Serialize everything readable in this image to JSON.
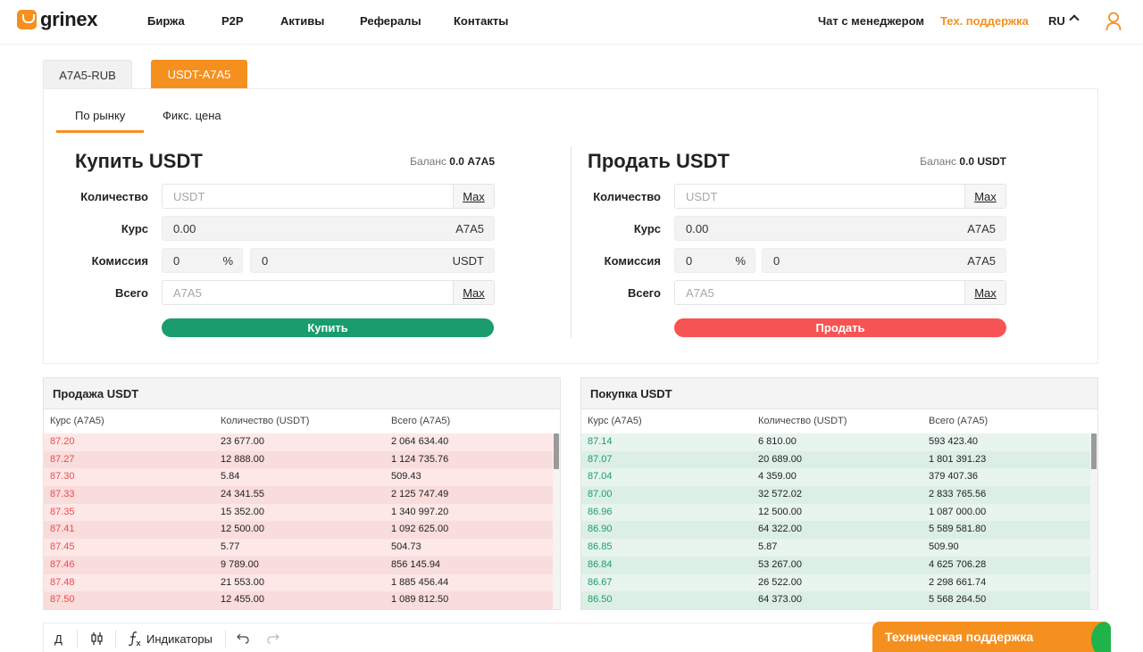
{
  "header": {
    "logo_text": "grinex",
    "nav": [
      "Биржа",
      "P2P",
      "Активы",
      "Рефералы",
      "Контакты"
    ],
    "chat_manager": "Чат с менеджером",
    "tech_support": "Тех. поддержка",
    "lang": "RU"
  },
  "pair_tabs": [
    "A7A5-RUB",
    "USDT-A7A5"
  ],
  "active_pair": "USDT-A7A5",
  "mode_tabs": [
    "По рынку",
    "Фикс. цена"
  ],
  "buy_form": {
    "title": "Купить USDT",
    "balance_label": "Баланс",
    "balance_value": "0.0 A7A5",
    "quantity_label": "Количество",
    "quantity_placeholder": "USDT",
    "max": "Max",
    "rate_label": "Курс",
    "rate_value": "0.00",
    "rate_currency": "A7A5",
    "fee_label": "Комиссия",
    "fee_percent": "0",
    "percent_sign": "%",
    "fee_amount": "0",
    "fee_currency": "USDT",
    "total_label": "Всего",
    "total_placeholder": "A7A5",
    "button": "Купить"
  },
  "sell_form": {
    "title": "Продать USDT",
    "balance_label": "Баланс",
    "balance_value": "0.0 USDT",
    "quantity_label": "Количество",
    "quantity_placeholder": "USDT",
    "max": "Max",
    "rate_label": "Курс",
    "rate_value": "0.00",
    "rate_currency": "A7A5",
    "fee_label": "Комиссия",
    "fee_percent": "0",
    "percent_sign": "%",
    "fee_amount": "0",
    "fee_currency": "A7A5",
    "total_label": "Всего",
    "total_placeholder": "A7A5",
    "button": "Продать"
  },
  "sell_book": {
    "title": "Продажа USDT",
    "columns": [
      "Курс (A7A5)",
      "Количество (USDT)",
      "Всего (A7A5)"
    ],
    "rows": [
      [
        "87.20",
        "23 677.00",
        "2 064 634.40"
      ],
      [
        "87.27",
        "12 888.00",
        "1 124 735.76"
      ],
      [
        "87.30",
        "5.84",
        "509.43"
      ],
      [
        "87.33",
        "24 341.55",
        "2 125 747.49"
      ],
      [
        "87.35",
        "15 352.00",
        "1 340 997.20"
      ],
      [
        "87.41",
        "12 500.00",
        "1 092 625.00"
      ],
      [
        "87.45",
        "5.77",
        "504.73"
      ],
      [
        "87.46",
        "9 789.00",
        "856 145.94"
      ],
      [
        "87.48",
        "21 553.00",
        "1 885 456.44"
      ],
      [
        "87.50",
        "12 455.00",
        "1 089 812.50"
      ]
    ]
  },
  "buy_book": {
    "title": "Покупка USDT",
    "columns": [
      "Курс (A7A5)",
      "Количество (USDT)",
      "Всего (A7A5)"
    ],
    "rows": [
      [
        "87.14",
        "6 810.00",
        "593 423.40"
      ],
      [
        "87.07",
        "20 689.00",
        "1 801 391.23"
      ],
      [
        "87.04",
        "4 359.00",
        "379 407.36"
      ],
      [
        "87.00",
        "32 572.02",
        "2 833 765.56"
      ],
      [
        "86.96",
        "12 500.00",
        "1 087 000.00"
      ],
      [
        "86.90",
        "64 322.00",
        "5 589 581.80"
      ],
      [
        "86.85",
        "5.87",
        "509.90"
      ],
      [
        "86.84",
        "53 267.00",
        "4 625 706.28"
      ],
      [
        "86.67",
        "26 522.00",
        "2 298 661.74"
      ],
      [
        "86.50",
        "64 373.00",
        "5 568 264.50"
      ]
    ]
  },
  "toolbar": {
    "interval": "Д",
    "indicators": "Индикаторы"
  },
  "support_widget": "Техническая поддержка",
  "colors": {
    "accent": "#f5901f",
    "buy": "#1a9d6e",
    "sell": "#f65454"
  }
}
